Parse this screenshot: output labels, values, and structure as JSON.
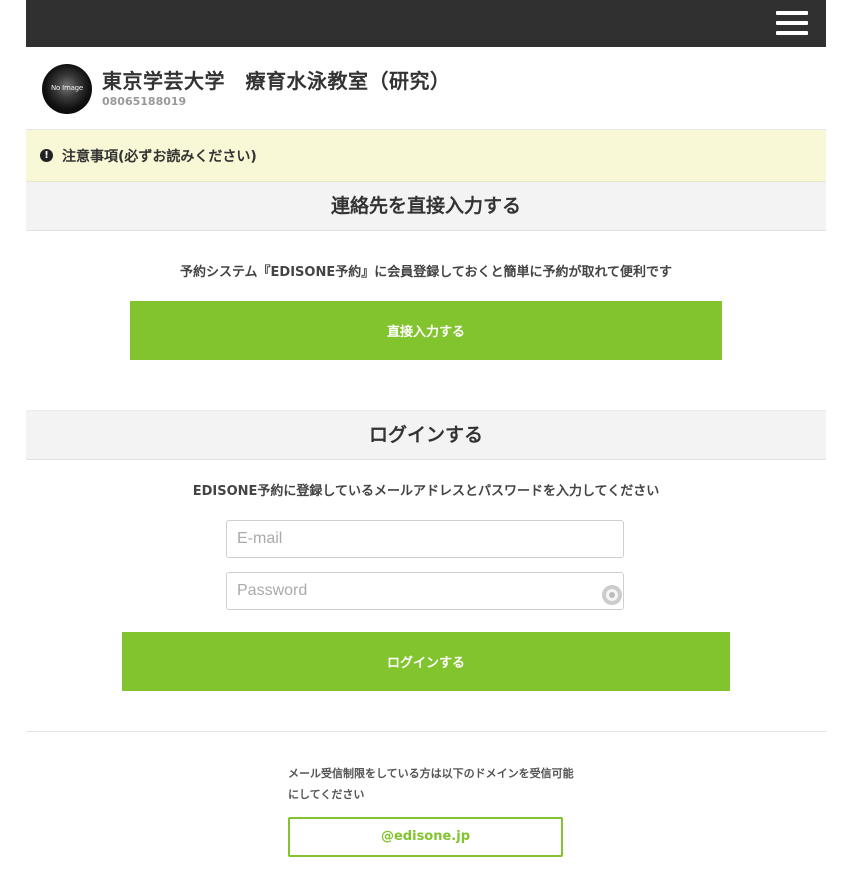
{
  "header": {
    "shop_name": "東京学芸大学　療育水泳教室（研究）",
    "phone": "08065188019",
    "logo_text": "No Image"
  },
  "notice": {
    "text": "注意事項(必ずお読みください)"
  },
  "direct_section": {
    "title": "連絡先を直接入力する",
    "description": "予約システム『EDISONE予約』に会員登録しておくと簡単に予約が取れて便利です",
    "button_label": "直接入力する"
  },
  "login_section": {
    "title": "ログインする",
    "description": "EDISONE予約に登録しているメールアドレスとパスワードを入力してください",
    "email_placeholder": "E-mail",
    "password_placeholder": "Password",
    "button_label": "ログインする"
  },
  "mail_note": {
    "text": "メール受信制限をしている方は以下のドメインを受信可能にしてください",
    "domain": "@edisone.jp"
  },
  "colors": {
    "topbar": "#303030",
    "accent_green": "#82c42e",
    "notice_bg": "#f8f8d6"
  }
}
